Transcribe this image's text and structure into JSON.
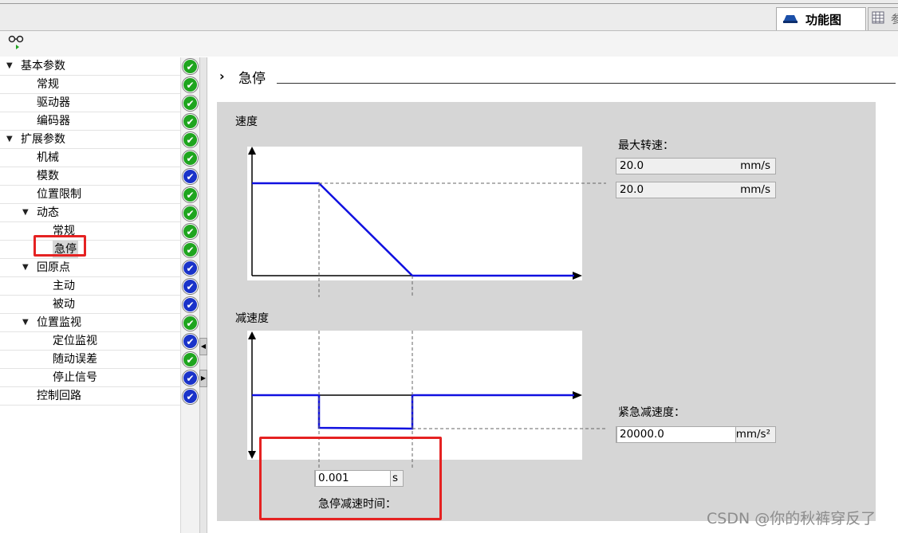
{
  "header": {
    "active_tab": "功能图",
    "inactive_tab": "参",
    "active_tab_icon": "function-view-icon",
    "inactive_tab_icon": "table-view-icon"
  },
  "tree": {
    "items": [
      {
        "label": "基本参数",
        "level": 0,
        "expandable": true,
        "status": "green"
      },
      {
        "label": "常规",
        "level": 1,
        "expandable": false,
        "status": "green"
      },
      {
        "label": "驱动器",
        "level": 1,
        "expandable": false,
        "status": "green"
      },
      {
        "label": "编码器",
        "level": 1,
        "expandable": false,
        "status": "green"
      },
      {
        "label": "扩展参数",
        "level": 0,
        "expandable": true,
        "status": "green"
      },
      {
        "label": "机械",
        "level": 1,
        "expandable": false,
        "status": "green"
      },
      {
        "label": "模数",
        "level": 1,
        "expandable": false,
        "status": "blue"
      },
      {
        "label": "位置限制",
        "level": 1,
        "expandable": false,
        "status": "green"
      },
      {
        "label": "动态",
        "level": 1,
        "expandable": true,
        "status": "green"
      },
      {
        "label": "常规",
        "level": 2,
        "expandable": false,
        "status": "green"
      },
      {
        "label": "急停",
        "level": 2,
        "expandable": false,
        "status": "green",
        "selected": true
      },
      {
        "label": "回原点",
        "level": 1,
        "expandable": true,
        "status": "blue"
      },
      {
        "label": "主动",
        "level": 2,
        "expandable": false,
        "status": "blue"
      },
      {
        "label": "被动",
        "level": 2,
        "expandable": false,
        "status": "blue"
      },
      {
        "label": "位置监视",
        "level": 1,
        "expandable": true,
        "status": "green"
      },
      {
        "label": "定位监视",
        "level": 2,
        "expandable": false,
        "status": "blue"
      },
      {
        "label": "随动误差",
        "level": 2,
        "expandable": false,
        "status": "green"
      },
      {
        "label": "停止信号",
        "level": 2,
        "expandable": false,
        "status": "blue"
      },
      {
        "label": "控制回路",
        "level": 1,
        "expandable": false,
        "status": "blue"
      }
    ]
  },
  "section": {
    "title": "急停"
  },
  "diagram": {
    "speed_label": "速度",
    "decel_label": "减速度",
    "max_speed_label": "最大转速：",
    "max_speed_value_1": "20.0",
    "max_speed_value_2": "20.0",
    "speed_unit": "mm/s",
    "emergency_decel_label": "紧急减速度：",
    "emergency_decel_value": "20000.0",
    "decel_unit": "mm/s²",
    "decel_time_value": "0.001",
    "decel_time_unit": "s",
    "decel_time_label": "急停减速时间："
  },
  "watermark": "CSDN @你的秋裤穿反了",
  "colors": {
    "status_green": "#1fa51f",
    "status_blue": "#1a33c9",
    "curve_blue": "#1010e0",
    "highlight_red": "#e52222"
  }
}
